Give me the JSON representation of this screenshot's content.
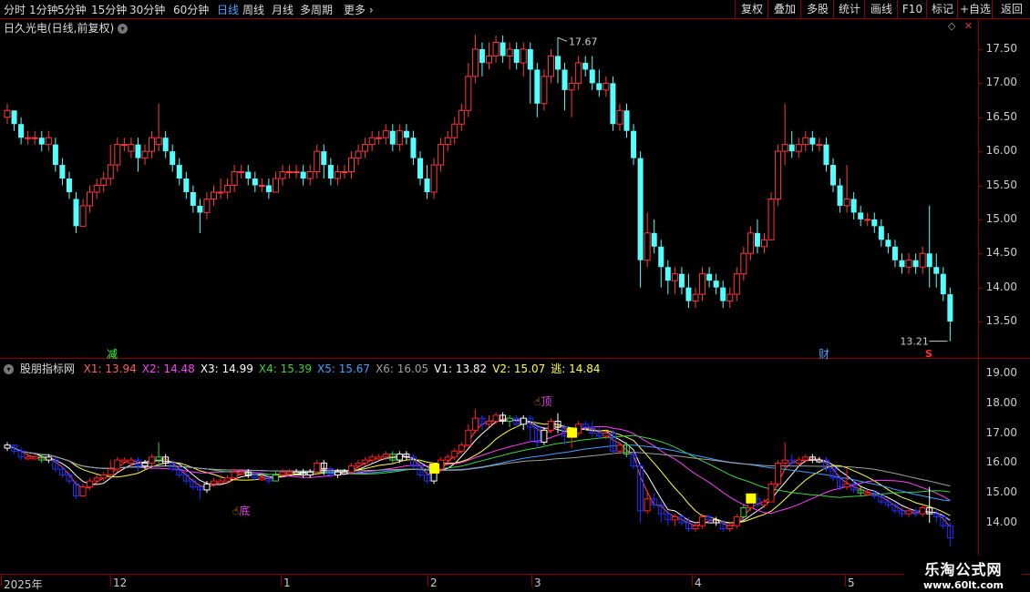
{
  "toolbar": {
    "periods": [
      "分时",
      "1分钟",
      "5分钟",
      "15分钟",
      "30分钟",
      "60分钟",
      "日线",
      "周线",
      "月线",
      "多周期",
      "更多"
    ],
    "active_period": "日线",
    "buttons": [
      "复权",
      "叠加",
      "多股",
      "统计",
      "画线",
      "F10",
      "标记",
      "+自选",
      "返回"
    ]
  },
  "main_panel": {
    "title": "日久光电(日线,前复权)",
    "y_ticks": [
      "17.50",
      "17.00",
      "16.50",
      "16.00",
      "15.50",
      "15.00",
      "14.50",
      "14.00",
      "13.50"
    ],
    "high_label": "17.67",
    "low_label": "13.21",
    "markers": {
      "jian": "减",
      "cai": "财",
      "s": "S"
    }
  },
  "indicator_panel": {
    "title": "股朋指标网",
    "legend": [
      {
        "label": "X1:",
        "value": "13.94",
        "color": "#ff6060"
      },
      {
        "label": "X2:",
        "value": "14.48",
        "color": "#ff40ff"
      },
      {
        "label": "X3:",
        "value": "14.99",
        "color": "#ffffff"
      },
      {
        "label": "X4:",
        "value": "15.39",
        "color": "#40d040"
      },
      {
        "label": "X5:",
        "value": "15.67",
        "color": "#40a0ff"
      },
      {
        "label": "X6:",
        "value": "16.05",
        "color": "#a0a0a0"
      },
      {
        "label": "V1:",
        "value": "13.82",
        "color": "#ffffff"
      },
      {
        "label": "V2:",
        "value": "15.07",
        "color": "#ffff40"
      },
      {
        "label": "逃:",
        "value": "14.84",
        "color": "#ffff40"
      }
    ],
    "y_ticks": [
      "19.00",
      "18.00",
      "17.00",
      "16.00",
      "15.00",
      "14.00"
    ],
    "markers": {
      "top": "顶",
      "bottom": "底"
    }
  },
  "dates": [
    {
      "label": "2025年"
    },
    {
      "label": "12"
    },
    {
      "label": "1"
    },
    {
      "label": "2"
    },
    {
      "label": "3"
    },
    {
      "label": "4"
    },
    {
      "label": "5"
    }
  ],
  "watermark": {
    "line1": "乐淘公式网",
    "line2": "www.60lt.com"
  },
  "chart_data": {
    "type": "candlestick",
    "title": "日久光电(日线,前复权)",
    "ylim": [
      13.0,
      17.9
    ],
    "annotations": [
      "17.67",
      "13.21"
    ],
    "candles": [
      [
        16.5,
        16.7,
        16.6,
        16.4
      ],
      [
        16.6,
        16.6,
        16.4,
        16.3
      ],
      [
        16.4,
        16.5,
        16.2,
        16.1
      ],
      [
        16.2,
        16.3,
        16.2,
        16.1
      ],
      [
        16.2,
        16.3,
        16.2,
        16.1
      ],
      [
        16.2,
        16.3,
        16.1,
        16.0
      ],
      [
        16.1,
        16.3,
        16.2,
        16.0
      ],
      [
        16.1,
        16.2,
        15.8,
        15.7
      ],
      [
        15.8,
        15.9,
        15.6,
        15.5
      ],
      [
        15.6,
        15.7,
        15.4,
        15.3
      ],
      [
        15.3,
        15.4,
        14.9,
        14.8
      ],
      [
        14.9,
        15.3,
        15.2,
        14.9
      ],
      [
        15.2,
        15.5,
        15.4,
        15.1
      ],
      [
        15.4,
        15.6,
        15.5,
        15.3
      ],
      [
        15.5,
        15.7,
        15.6,
        15.4
      ],
      [
        15.6,
        16.1,
        15.8,
        15.5
      ],
      [
        15.8,
        16.2,
        16.1,
        15.7
      ],
      [
        16.1,
        16.2,
        16.1,
        16.0
      ],
      [
        16.0,
        16.2,
        16.1,
        15.9
      ],
      [
        16.1,
        16.2,
        15.9,
        15.7
      ],
      [
        15.9,
        16.1,
        16.0,
        15.8
      ],
      [
        16.0,
        16.3,
        16.2,
        15.9
      ],
      [
        16.1,
        16.7,
        16.2,
        16.0
      ],
      [
        16.2,
        16.3,
        16.0,
        15.9
      ],
      [
        16.0,
        16.1,
        15.8,
        15.7
      ],
      [
        15.8,
        15.9,
        15.6,
        15.5
      ],
      [
        15.6,
        15.7,
        15.4,
        15.3
      ],
      [
        15.4,
        15.5,
        15.2,
        15.1
      ],
      [
        15.2,
        15.3,
        15.1,
        14.8
      ],
      [
        15.1,
        15.4,
        15.3,
        15.0
      ],
      [
        15.3,
        15.5,
        15.4,
        15.2
      ],
      [
        15.4,
        15.6,
        15.4,
        15.3
      ],
      [
        15.4,
        15.6,
        15.5,
        15.3
      ],
      [
        15.5,
        15.8,
        15.7,
        15.4
      ],
      [
        15.7,
        15.8,
        15.7,
        15.6
      ],
      [
        15.7,
        15.8,
        15.6,
        15.5
      ],
      [
        15.6,
        15.7,
        15.5,
        15.4
      ],
      [
        15.5,
        15.6,
        15.5,
        15.4
      ],
      [
        15.5,
        15.6,
        15.4,
        15.3
      ],
      [
        15.4,
        15.7,
        15.6,
        15.4
      ],
      [
        15.6,
        15.8,
        15.7,
        15.5
      ],
      [
        15.7,
        15.8,
        15.7,
        15.6
      ],
      [
        15.7,
        15.8,
        15.7,
        15.6
      ],
      [
        15.7,
        15.8,
        15.6,
        15.5
      ],
      [
        15.6,
        15.8,
        15.7,
        15.5
      ],
      [
        15.7,
        16.1,
        16.0,
        15.6
      ],
      [
        16.0,
        16.1,
        15.8,
        15.6
      ],
      [
        15.8,
        15.9,
        15.6,
        15.5
      ],
      [
        15.6,
        15.8,
        15.7,
        15.5
      ],
      [
        15.7,
        15.8,
        15.7,
        15.6
      ],
      [
        15.7,
        16.0,
        15.9,
        15.6
      ],
      [
        15.9,
        16.1,
        16.0,
        15.8
      ],
      [
        16.0,
        16.2,
        16.1,
        15.9
      ],
      [
        16.1,
        16.3,
        16.2,
        16.0
      ],
      [
        16.2,
        16.3,
        16.2,
        16.1
      ],
      [
        16.2,
        16.4,
        16.3,
        16.1
      ],
      [
        16.3,
        16.4,
        16.1,
        16.0
      ],
      [
        16.1,
        16.4,
        16.3,
        16.0
      ],
      [
        16.3,
        16.4,
        16.2,
        16.1
      ],
      [
        16.2,
        16.3,
        15.9,
        15.8
      ],
      [
        15.9,
        16.0,
        15.6,
        15.5
      ],
      [
        15.6,
        15.8,
        15.4,
        15.3
      ],
      [
        15.4,
        15.9,
        15.8,
        15.3
      ],
      [
        15.8,
        16.2,
        16.1,
        15.7
      ],
      [
        16.1,
        16.3,
        16.2,
        16.0
      ],
      [
        16.2,
        16.5,
        16.4,
        16.1
      ],
      [
        16.4,
        16.7,
        16.6,
        16.3
      ],
      [
        16.6,
        17.3,
        17.1,
        16.5
      ],
      [
        17.1,
        17.8,
        17.5,
        17.0
      ],
      [
        17.5,
        17.6,
        17.3,
        17.1
      ],
      [
        17.3,
        17.6,
        17.4,
        17.2
      ],
      [
        17.4,
        17.7,
        17.6,
        17.3
      ],
      [
        17.6,
        17.7,
        17.4,
        17.3
      ],
      [
        17.4,
        17.6,
        17.5,
        17.2
      ],
      [
        17.5,
        17.6,
        17.3,
        17.2
      ],
      [
        17.3,
        17.6,
        17.5,
        17.1
      ],
      [
        17.5,
        17.6,
        17.2,
        16.7
      ],
      [
        17.2,
        17.3,
        16.7,
        16.5
      ],
      [
        16.7,
        17.2,
        17.1,
        16.6
      ],
      [
        17.1,
        17.5,
        17.4,
        17.0
      ],
      [
        17.4,
        17.67,
        17.2,
        17.0
      ],
      [
        17.2,
        17.3,
        16.9,
        16.6
      ],
      [
        16.9,
        17.1,
        17.0,
        16.5
      ],
      [
        17.0,
        17.4,
        17.3,
        16.9
      ],
      [
        17.3,
        17.4,
        17.2,
        17.1
      ],
      [
        17.2,
        17.4,
        17.0,
        16.9
      ],
      [
        17.0,
        17.2,
        16.9,
        16.8
      ],
      [
        16.9,
        17.1,
        17.0,
        16.8
      ],
      [
        17.0,
        17.1,
        16.4,
        16.3
      ],
      [
        16.4,
        16.7,
        16.6,
        16.3
      ],
      [
        16.6,
        16.7,
        16.3,
        16.2
      ],
      [
        16.3,
        16.4,
        15.9,
        15.8
      ],
      [
        15.9,
        16.0,
        14.4,
        14.0
      ],
      [
        14.4,
        15.1,
        14.8,
        14.3
      ],
      [
        14.8,
        15.0,
        14.6,
        14.5
      ],
      [
        14.6,
        14.7,
        14.3,
        14.0
      ],
      [
        14.3,
        14.4,
        14.1,
        13.9
      ],
      [
        14.1,
        14.3,
        14.2,
        13.9
      ],
      [
        14.2,
        14.3,
        14.0,
        13.9
      ],
      [
        14.0,
        14.2,
        13.8,
        13.7
      ],
      [
        13.8,
        14.0,
        13.9,
        13.7
      ],
      [
        13.9,
        14.3,
        14.2,
        13.8
      ],
      [
        14.2,
        14.3,
        14.1,
        14.0
      ],
      [
        14.1,
        14.2,
        14.0,
        13.9
      ],
      [
        14.0,
        14.1,
        13.8,
        13.7
      ],
      [
        13.8,
        14.0,
        13.9,
        13.7
      ],
      [
        13.9,
        14.3,
        14.2,
        13.8
      ],
      [
        14.2,
        14.6,
        14.5,
        14.1
      ],
      [
        14.5,
        14.9,
        14.8,
        14.4
      ],
      [
        14.8,
        15.0,
        14.6,
        14.5
      ],
      [
        14.6,
        14.8,
        14.7,
        14.5
      ],
      [
        14.7,
        15.4,
        15.3,
        14.9
      ],
      [
        15.3,
        16.1,
        16.0,
        15.2
      ],
      [
        16.0,
        16.7,
        16.1,
        15.8
      ],
      [
        16.1,
        16.3,
        16.0,
        15.9
      ],
      [
        16.0,
        16.2,
        16.1,
        15.9
      ],
      [
        16.1,
        16.3,
        16.2,
        16.0
      ],
      [
        16.2,
        16.3,
        16.1,
        16.0
      ],
      [
        16.1,
        16.2,
        16.1,
        16.0
      ],
      [
        16.1,
        16.2,
        15.8,
        15.7
      ],
      [
        15.8,
        15.9,
        15.5,
        15.4
      ],
      [
        15.5,
        15.6,
        15.2,
        15.1
      ],
      [
        15.2,
        15.8,
        15.3,
        15.1
      ],
      [
        15.3,
        15.4,
        15.1,
        15.0
      ],
      [
        15.1,
        15.2,
        15.0,
        14.9
      ],
      [
        15.0,
        15.1,
        15.0,
        14.9
      ],
      [
        15.0,
        15.1,
        14.9,
        14.8
      ],
      [
        14.9,
        15.0,
        14.7,
        14.6
      ],
      [
        14.7,
        14.8,
        14.6,
        14.5
      ],
      [
        14.6,
        14.7,
        14.4,
        14.3
      ],
      [
        14.4,
        14.5,
        14.3,
        14.2
      ],
      [
        14.3,
        14.5,
        14.4,
        14.2
      ],
      [
        14.4,
        14.5,
        14.3,
        14.2
      ],
      [
        14.3,
        14.6,
        14.5,
        14.2
      ],
      [
        14.5,
        15.2,
        14.3,
        14.0
      ],
      [
        14.3,
        14.5,
        14.2,
        14.0
      ],
      [
        14.2,
        14.3,
        13.9,
        13.8
      ],
      [
        13.9,
        14.0,
        13.5,
        13.21
      ]
    ]
  }
}
